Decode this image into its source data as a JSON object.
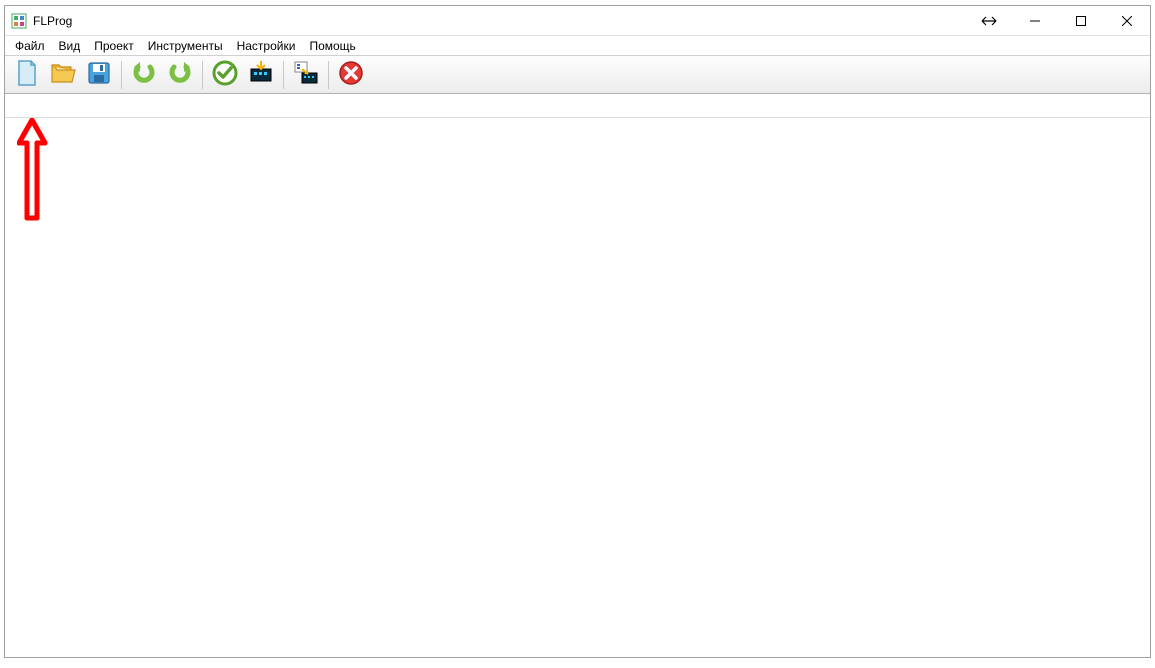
{
  "window": {
    "title": "FLProg"
  },
  "menu": {
    "items": [
      {
        "label": "Файл"
      },
      {
        "label": "Вид"
      },
      {
        "label": "Проект"
      },
      {
        "label": "Инструменты"
      },
      {
        "label": "Настройки"
      },
      {
        "label": "Помощь"
      }
    ]
  },
  "toolbar": {
    "buttons": [
      {
        "name": "new-file-icon"
      },
      {
        "name": "open-folder-icon"
      },
      {
        "name": "save-icon"
      },
      {
        "sep": true
      },
      {
        "name": "undo-icon"
      },
      {
        "name": "redo-icon"
      },
      {
        "sep": true
      },
      {
        "name": "check-icon"
      },
      {
        "name": "compile-icon"
      },
      {
        "sep": true
      },
      {
        "name": "upload-icon"
      },
      {
        "sep": true
      },
      {
        "name": "stop-icon"
      }
    ]
  }
}
